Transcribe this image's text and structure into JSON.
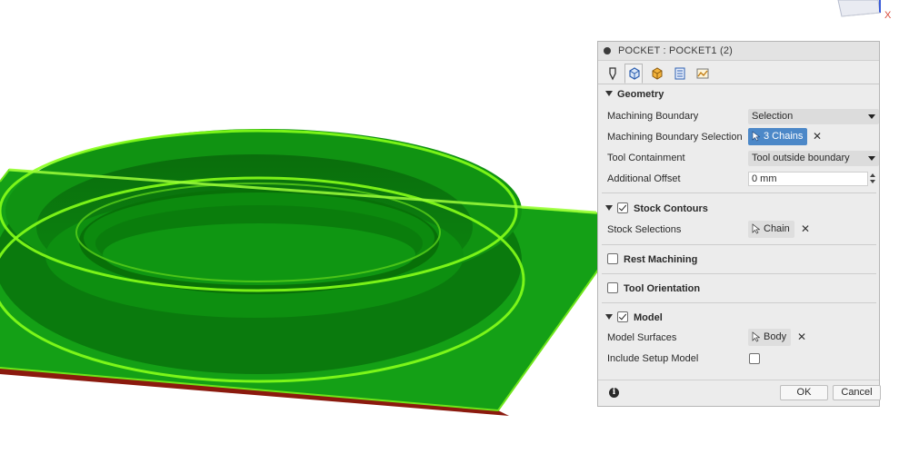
{
  "viewcube": {
    "axis_label": "X"
  },
  "dialog": {
    "title": "POCKET : POCKET1 (2)",
    "tabs": [
      {
        "name": "tool-tab-icon",
        "active": false
      },
      {
        "name": "geometry-tab-icon",
        "active": true
      },
      {
        "name": "heights-tab-icon",
        "active": false
      },
      {
        "name": "passes-tab-icon",
        "active": false
      },
      {
        "name": "linking-tab-icon",
        "active": false
      }
    ],
    "geometry": {
      "header": "Geometry",
      "machining_boundary_label": "Machining Boundary",
      "machining_boundary_value": "Selection",
      "boundary_selection_label": "Machining Boundary Selection",
      "boundary_selection_value": "3 Chains",
      "tool_containment_label": "Tool Containment",
      "tool_containment_value": "Tool outside boundary",
      "additional_offset_label": "Additional Offset",
      "additional_offset_value": "0 mm"
    },
    "stock_contours": {
      "header": "Stock Contours",
      "checked": true,
      "stock_selections_label": "Stock Selections",
      "stock_selections_value": "Chain"
    },
    "rest_machining": {
      "header": "Rest Machining",
      "checked": false
    },
    "tool_orientation": {
      "header": "Tool Orientation",
      "checked": false
    },
    "model": {
      "header": "Model",
      "checked": true,
      "model_surfaces_label": "Model Surfaces",
      "model_surfaces_value": "Body",
      "include_setup_label": "Include Setup Model",
      "include_setup_checked": false
    },
    "footer": {
      "info_glyph": "i",
      "ok_label": "OK",
      "cancel_label": "Cancel"
    }
  },
  "colors": {
    "part_green": "#0f8a12",
    "highlight_green": "#7dff00",
    "selection_blue": "#4c88c8",
    "base_bottom_red": "#8b1a0e"
  }
}
